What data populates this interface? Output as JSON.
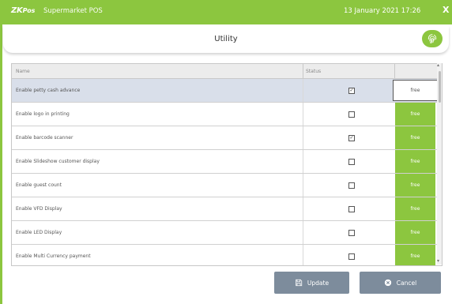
{
  "titlebar": {
    "logo_main": "ZK",
    "logo_sub": "Pos",
    "app_name": "Supermarket POS",
    "datetime": "13 January 2021 17:26",
    "close_label": "X",
    "color": "#8cc63f"
  },
  "header": {
    "title": "Utility",
    "fingerprint_icon": "fingerprint-icon"
  },
  "table": {
    "col_name": "Name",
    "col_status": "Status",
    "rows": [
      {
        "name": "Enable petty cash advance",
        "checked": true,
        "action": "free",
        "selected": true
      },
      {
        "name": "Enable logo in printing",
        "checked": false,
        "action": "free",
        "selected": false
      },
      {
        "name": "Enable barcode scanner",
        "checked": true,
        "action": "free",
        "selected": false
      },
      {
        "name": "Enable Slideshow customer display",
        "checked": false,
        "action": "free",
        "selected": false
      },
      {
        "name": "Enable guest count",
        "checked": false,
        "action": "free",
        "selected": false
      },
      {
        "name": "Enable VFD Display",
        "checked": false,
        "action": "free",
        "selected": false
      },
      {
        "name": "Enable LED Display",
        "checked": false,
        "action": "free",
        "selected": false
      },
      {
        "name": "Enable Multi Currency payment",
        "checked": false,
        "action": "free",
        "selected": false
      }
    ]
  },
  "buttons": {
    "update": "Update",
    "cancel": "Cancel"
  }
}
